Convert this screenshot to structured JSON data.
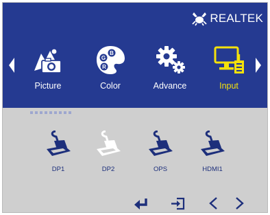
{
  "brand": {
    "name": "REALTEK",
    "logo_icon": "realtek-crab-logo"
  },
  "nav": {
    "left_icon": "arrow-left-icon",
    "right_icon": "arrow-right-icon"
  },
  "menu": {
    "items": [
      {
        "label": "Picture",
        "icon": "picture-icon"
      },
      {
        "label": "Color",
        "icon": "color-palette-icon"
      },
      {
        "label": "Advance",
        "icon": "gears-icon"
      },
      {
        "label": "Input",
        "icon": "input-monitor-icon",
        "active": true
      }
    ],
    "active_color": "#f4e10b"
  },
  "sources": [
    {
      "label": "DP1",
      "icon": "connector-icon"
    },
    {
      "label": "DP2",
      "icon": "connector-icon",
      "highlighted": true
    },
    {
      "label": "OPS",
      "icon": "connector-icon"
    },
    {
      "label": "HDMI1",
      "icon": "connector-icon"
    }
  ],
  "controls": [
    "enter-icon",
    "exit-icon",
    "previous-icon",
    "next-icon"
  ],
  "colors": {
    "header_bg": "#253a91",
    "body_bg": "#cfcfcf",
    "icon_blue": "#1d2f7b"
  }
}
